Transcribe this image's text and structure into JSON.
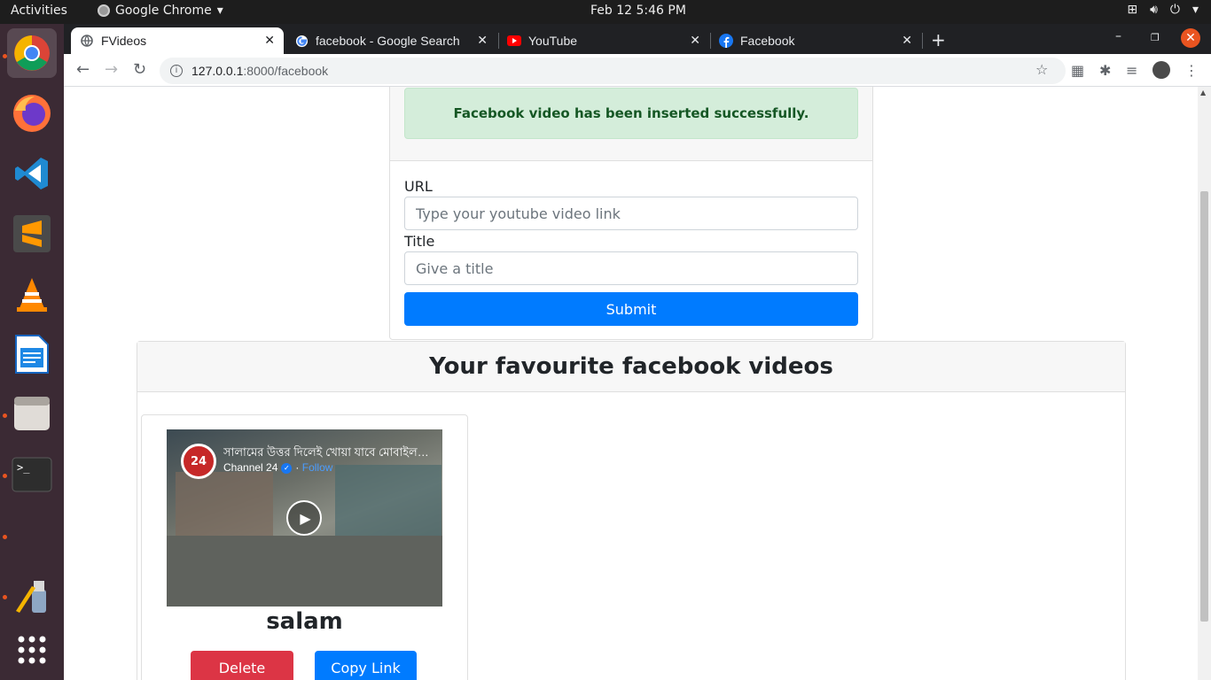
{
  "topbar": {
    "activities": "Activities",
    "app_name": "Google Chrome",
    "clock": "Feb 12  5:46 PM"
  },
  "dock": {
    "apps": [
      "chrome-icon",
      "firefox-icon",
      "vscode-icon",
      "sublime-text-icon",
      "vlc-icon",
      "libreoffice-writer-icon",
      "files-icon",
      "terminal-icon",
      "text-editor-icon",
      "show-apps-icon"
    ]
  },
  "tabs": [
    {
      "label": "FVideos",
      "active": true,
      "favicon": "globe-icon"
    },
    {
      "label": "facebook - Google Search",
      "active": false,
      "favicon": "google-icon"
    },
    {
      "label": "YouTube",
      "active": false,
      "favicon": "youtube-icon"
    },
    {
      "label": "Facebook",
      "active": false,
      "favicon": "facebook-icon"
    }
  ],
  "address_bar": {
    "host": "127.0.0.1",
    "path": ":8000/facebook"
  },
  "form": {
    "alert": "Facebook video has been inserted successfully.",
    "url_label": "URL",
    "url_placeholder": "Type your youtube video link",
    "title_label": "Title",
    "title_placeholder": "Give a title",
    "submit_label": "Submit"
  },
  "list": {
    "heading": "Your favourite facebook videos",
    "videos": [
      {
        "embed_title": "সালামের উত্তর দিলেই খোয়া যাবে মোবাইল-মানি...",
        "channel": "Channel 24",
        "channel_logo": "24",
        "follow": "Follow",
        "name": "salam",
        "delete_label": "Delete",
        "copy_label": "Copy Link"
      }
    ]
  },
  "colors": {
    "primary": "#007bff",
    "danger": "#dc3545",
    "success_bg": "#d4edda",
    "success_text": "#155724"
  }
}
